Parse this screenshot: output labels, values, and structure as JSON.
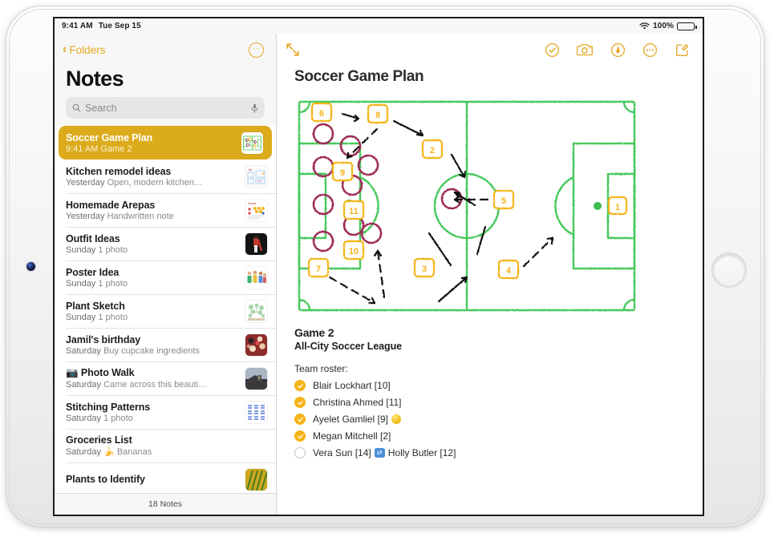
{
  "status_bar": {
    "time": "9:41 AM",
    "date": "Tue Sep 15",
    "wifi_icon": "wifi-icon",
    "battery_percent": "100%",
    "battery_icon": "battery-full-icon"
  },
  "sidebar": {
    "back_label": "Folders",
    "back_icon": "chevron-left-icon",
    "more_icon": "ellipsis-circle-icon",
    "title": "Notes",
    "search": {
      "placeholder": "Search",
      "search_icon": "search-icon",
      "mic_icon": "microphone-icon"
    },
    "footer": "18 Notes",
    "notes": [
      {
        "title": "Soccer Game Plan",
        "date": "9:41 AM",
        "preview": "Game 2",
        "selected": true,
        "thumb": "soccer-field-thumb"
      },
      {
        "title": "Kitchen remodel ideas",
        "date": "Yesterday",
        "preview": "Open, modern kitchen…",
        "selected": false,
        "thumb": "kitchen-sketch-thumb"
      },
      {
        "title": "Homemade Arepas",
        "date": "Yesterday",
        "preview": "Handwritten note",
        "selected": false,
        "thumb": "recipe-note-thumb"
      },
      {
        "title": "Outfit Ideas",
        "date": "Sunday",
        "preview": "1 photo",
        "selected": false,
        "thumb": "outfit-photo-thumb"
      },
      {
        "title": "Poster Idea",
        "date": "Sunday",
        "preview": "1 photo",
        "selected": false,
        "thumb": "poster-people-thumb"
      },
      {
        "title": "Plant Sketch",
        "date": "Sunday",
        "preview": "1 photo",
        "selected": false,
        "thumb": "plant-sketch-thumb"
      },
      {
        "title": "Jamil's birthday",
        "date": "Saturday",
        "preview": "Buy cupcake ingredients",
        "selected": false,
        "thumb": "cupcakes-photo-thumb"
      },
      {
        "title": "📷 Photo Walk",
        "date": "Saturday",
        "preview": "Came across this beauti…",
        "selected": false,
        "thumb": "landscape-photo-thumb"
      },
      {
        "title": "Stitching Patterns",
        "date": "Saturday",
        "preview": "1 photo",
        "selected": false,
        "thumb": "stitching-pattern-thumb"
      },
      {
        "title": "Groceries List",
        "date": "Saturday",
        "preview": "🍌 Bananas",
        "selected": false,
        "thumb": "none"
      },
      {
        "title": "Plants to Identify",
        "date": "",
        "preview": "",
        "selected": false,
        "thumb": "leaves-photo-thumb"
      }
    ]
  },
  "detail": {
    "expand_icon": "expand-diagonal-icon",
    "toolbar": [
      {
        "icon": "checklist-circle-icon",
        "name": "checklist-button"
      },
      {
        "icon": "camera-icon",
        "name": "camera-button"
      },
      {
        "icon": "markup-pen-circle-icon",
        "name": "markup-button"
      },
      {
        "icon": "ellipsis-circle-icon",
        "name": "more-button"
      },
      {
        "icon": "compose-square-pencil-icon",
        "name": "compose-button"
      }
    ],
    "title": "Soccer Game Plan",
    "heading": "Game 2",
    "subheading": "All-City Soccer League",
    "roster_label": "Team roster:",
    "roster": [
      {
        "checked": true,
        "text": "Blair Lockhart [10]",
        "emoji": "none"
      },
      {
        "checked": true,
        "text": "Christina Ahmed [11]",
        "emoji": "none"
      },
      {
        "checked": true,
        "text": "Ayelet Gamliel [9]",
        "emoji": "yellow-ball"
      },
      {
        "checked": true,
        "text": "Megan Mitchell [2]",
        "emoji": "none"
      },
      {
        "checked": false,
        "text": "Vera Sun [14]",
        "emoji": "swap-arrows",
        "text2": "Holly Butler [12]"
      }
    ],
    "diagram": {
      "name": "soccer-field-tactics-drawing",
      "colors": {
        "field_line": "#45c85a",
        "player": "#9e2a52",
        "marker": "#f5b417",
        "arrow": "#111111"
      },
      "player_markers": [
        "6",
        "8",
        "2",
        "5",
        "9",
        "11",
        "10",
        "7",
        "3",
        "4",
        "1"
      ]
    }
  }
}
